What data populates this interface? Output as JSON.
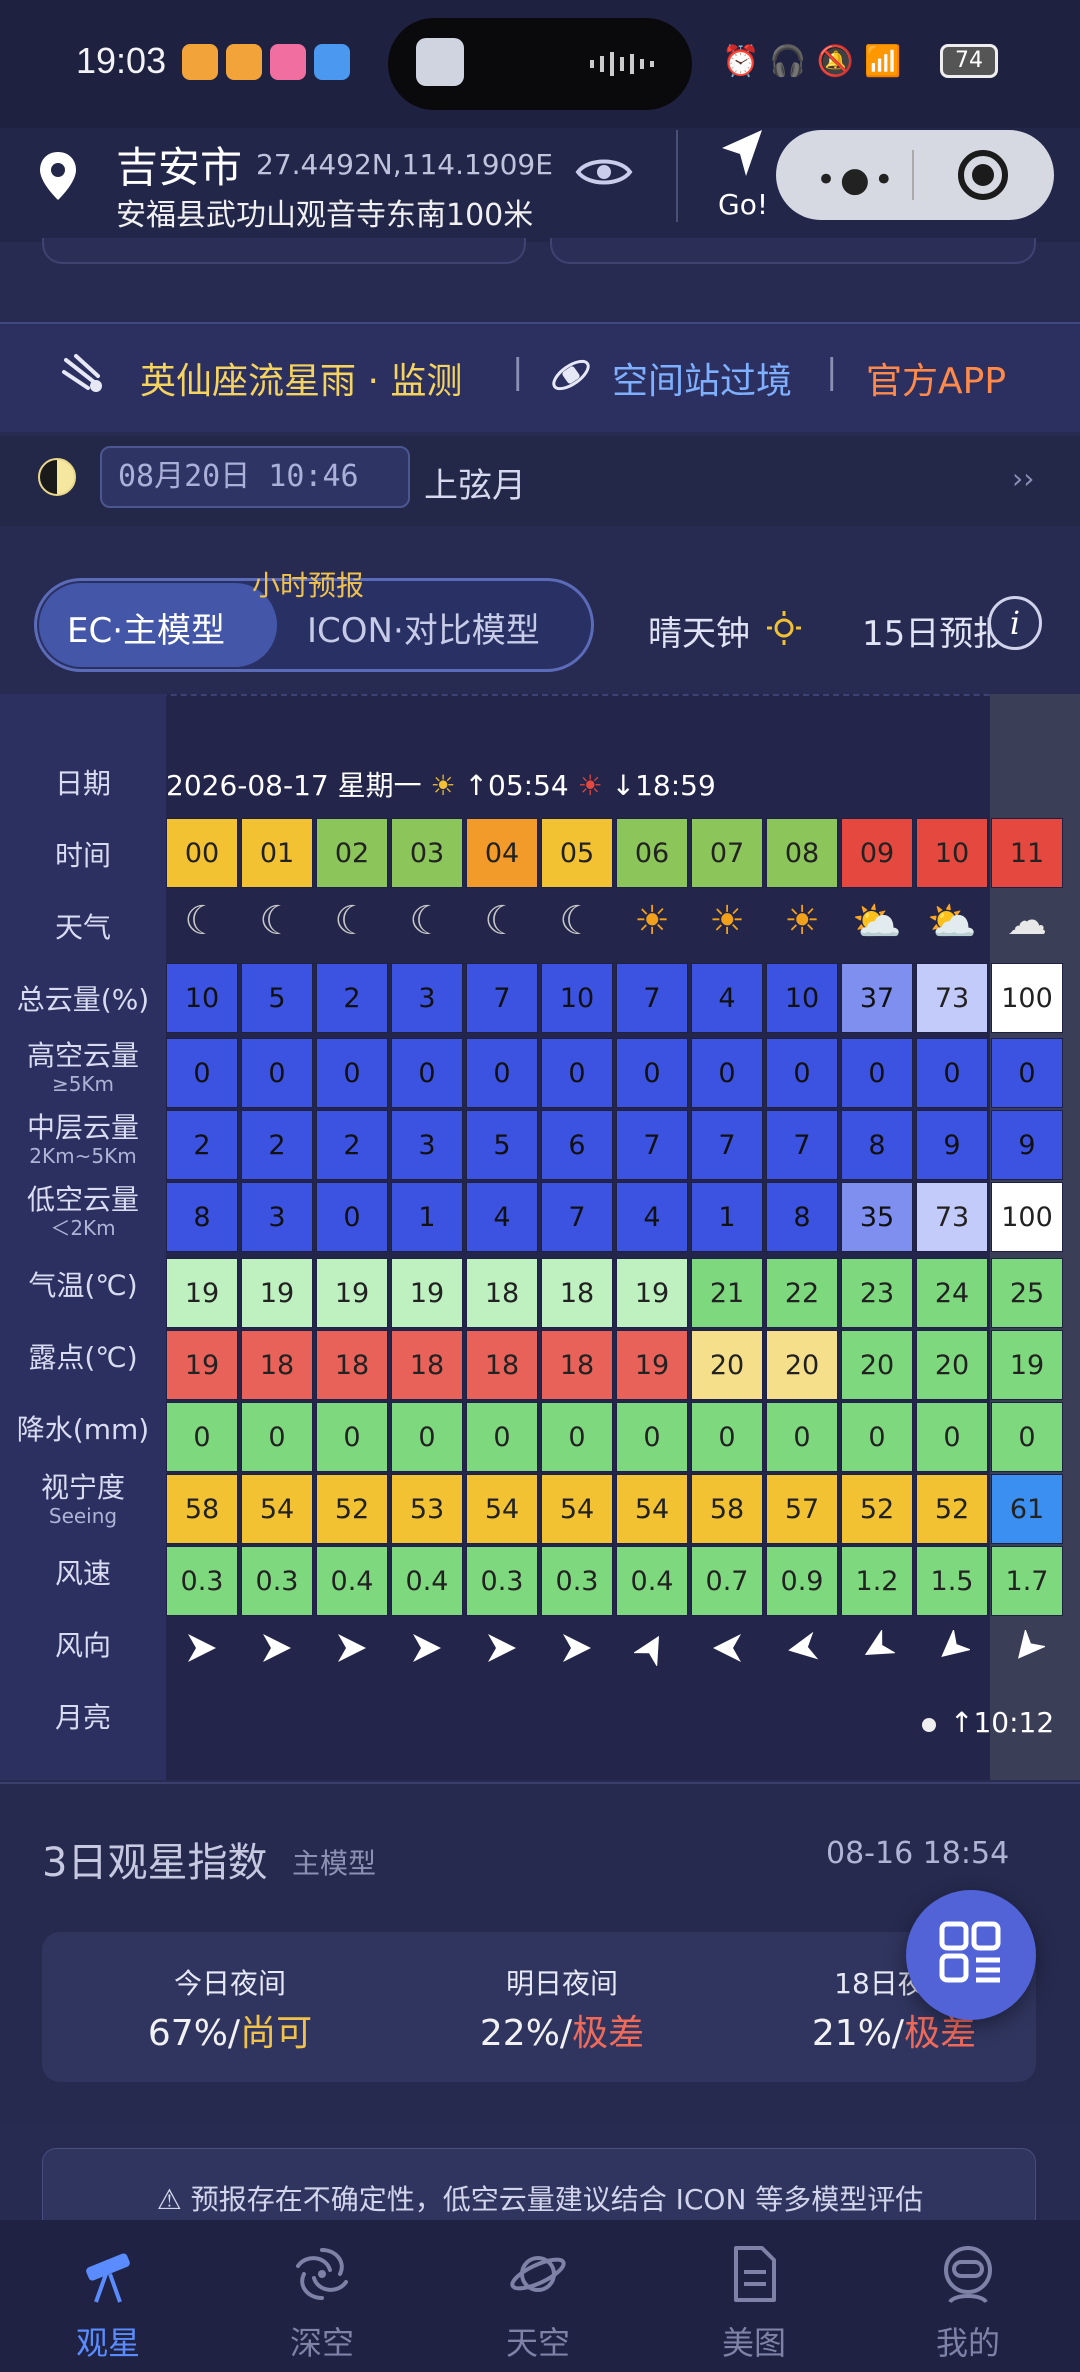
{
  "status_bar": {
    "time": "19:03",
    "battery": "74"
  },
  "location": {
    "city": "吉安市",
    "coords": "27.4492N,114.1909E",
    "address": "安福县武功山观音寺东南100米",
    "go_label": "Go!"
  },
  "promo": {
    "meteor_text": "英仙座流星雨 · 监测",
    "divider": "|",
    "iss_text": "空间站过境",
    "app_text": "官方APP"
  },
  "moon": {
    "date_time": "08月20日 10:46",
    "phase": "上弦月",
    "more": "››"
  },
  "tabs": {
    "model_a": "EC·主模型",
    "model_b": "ICON·对比模型",
    "hourly_label": "小时预报",
    "clear_sky": "晴天钟",
    "day15": "15日预报",
    "info": "i"
  },
  "forecast": {
    "date_line": "2026-08-17 星期一",
    "sunrise": "↑05:54",
    "sunset": "↓18:59",
    "labels": {
      "date": "日期",
      "time": "时间",
      "weather": "天气",
      "total_cloud": "总云量(%)",
      "high_cloud": "高空云量",
      "high_cloud_sub": "≥5Km",
      "mid_cloud": "中层云量",
      "mid_cloud_sub": "2Km~5Km",
      "low_cloud": "低空云量",
      "low_cloud_sub": "＜2Km",
      "temp": "气温(℃)",
      "dew": "露点(℃)",
      "precip": "降水(mm)",
      "seeing": "视宁度",
      "seeing_sub": "Seeing",
      "wind_speed": "风速",
      "wind_dir": "风向",
      "moon": "月亮"
    },
    "hours": [
      "00",
      "01",
      "02",
      "03",
      "04",
      "05",
      "06",
      "07",
      "08",
      "09",
      "10",
      "11"
    ],
    "weather": [
      "moon",
      "moon",
      "moon",
      "moon",
      "moon",
      "moon",
      "sun",
      "sun",
      "sun",
      "sun-cloud",
      "sun-cloud",
      "cloud"
    ],
    "total_cloud": [
      "10",
      "5",
      "2",
      "3",
      "7",
      "10",
      "7",
      "4",
      "10",
      "37",
      "73",
      "100"
    ],
    "high_cloud": [
      "0",
      "0",
      "0",
      "0",
      "0",
      "0",
      "0",
      "0",
      "0",
      "0",
      "0",
      "0"
    ],
    "mid_cloud": [
      "2",
      "2",
      "2",
      "3",
      "5",
      "6",
      "7",
      "7",
      "7",
      "8",
      "9",
      "9"
    ],
    "low_cloud": [
      "8",
      "3",
      "0",
      "1",
      "4",
      "7",
      "4",
      "1",
      "8",
      "35",
      "73",
      "100"
    ],
    "temp": [
      "19",
      "19",
      "19",
      "19",
      "18",
      "18",
      "19",
      "21",
      "22",
      "23",
      "24",
      "25"
    ],
    "dew": [
      "19",
      "18",
      "18",
      "18",
      "18",
      "18",
      "19",
      "20",
      "20",
      "20",
      "20",
      "19"
    ],
    "precip": [
      "0",
      "0",
      "0",
      "0",
      "0",
      "0",
      "0",
      "0",
      "0",
      "0",
      "0",
      "0"
    ],
    "seeing": [
      "58",
      "54",
      "52",
      "53",
      "54",
      "54",
      "54",
      "58",
      "57",
      "52",
      "52",
      "61"
    ],
    "wind_speed": [
      "0.3",
      "0.3",
      "0.4",
      "0.4",
      "0.3",
      "0.3",
      "0.4",
      "0.7",
      "0.9",
      "1.2",
      "1.5",
      "1.7"
    ],
    "wind_dir_deg": [
      0,
      0,
      0,
      0,
      0,
      0,
      300,
      180,
      170,
      150,
      140,
      130
    ],
    "moonrise": "↑10:12",
    "colors": {
      "hour_yellow": "#f2c232",
      "hour_orange": "#f29a2a",
      "hour_green": "#8cc55a",
      "hour_red": "#e4483e",
      "cloud_blue": "#3c52e0",
      "cloud_light": "#7f8ff0",
      "cloud_pale": "#c3cbfa",
      "white": "#ffffff",
      "temp_pale": "#bff0c0",
      "temp_green": "#7ed87e",
      "dew_red": "#e8625a",
      "dew_yellow": "#f6df8a",
      "seeing_yellow": "#f2c232",
      "seeing_blue": "#3b8ff0",
      "wind_green": "#7ed87e"
    }
  },
  "index": {
    "title": "3日观星指数",
    "subtitle": "主模型",
    "updated": "08-16 18:54",
    "nights": [
      {
        "label": "今日夜间",
        "pct": "67%/",
        "grade": "尚可",
        "grade_color": "#f0c24b"
      },
      {
        "label": "明日夜间",
        "pct": "22%/",
        "grade": "极差",
        "grade_color": "#f06a5a"
      },
      {
        "label": "18日夜间",
        "pct": "21%/",
        "grade": "极差",
        "grade_color": "#f06a5a"
      }
    ]
  },
  "warning": "⚠ 预报存在不确定性，低空云量建议结合 ICON 等多模型评估",
  "bottom_nav": [
    "观星",
    "深空",
    "天空",
    "美图",
    "我的"
  ]
}
